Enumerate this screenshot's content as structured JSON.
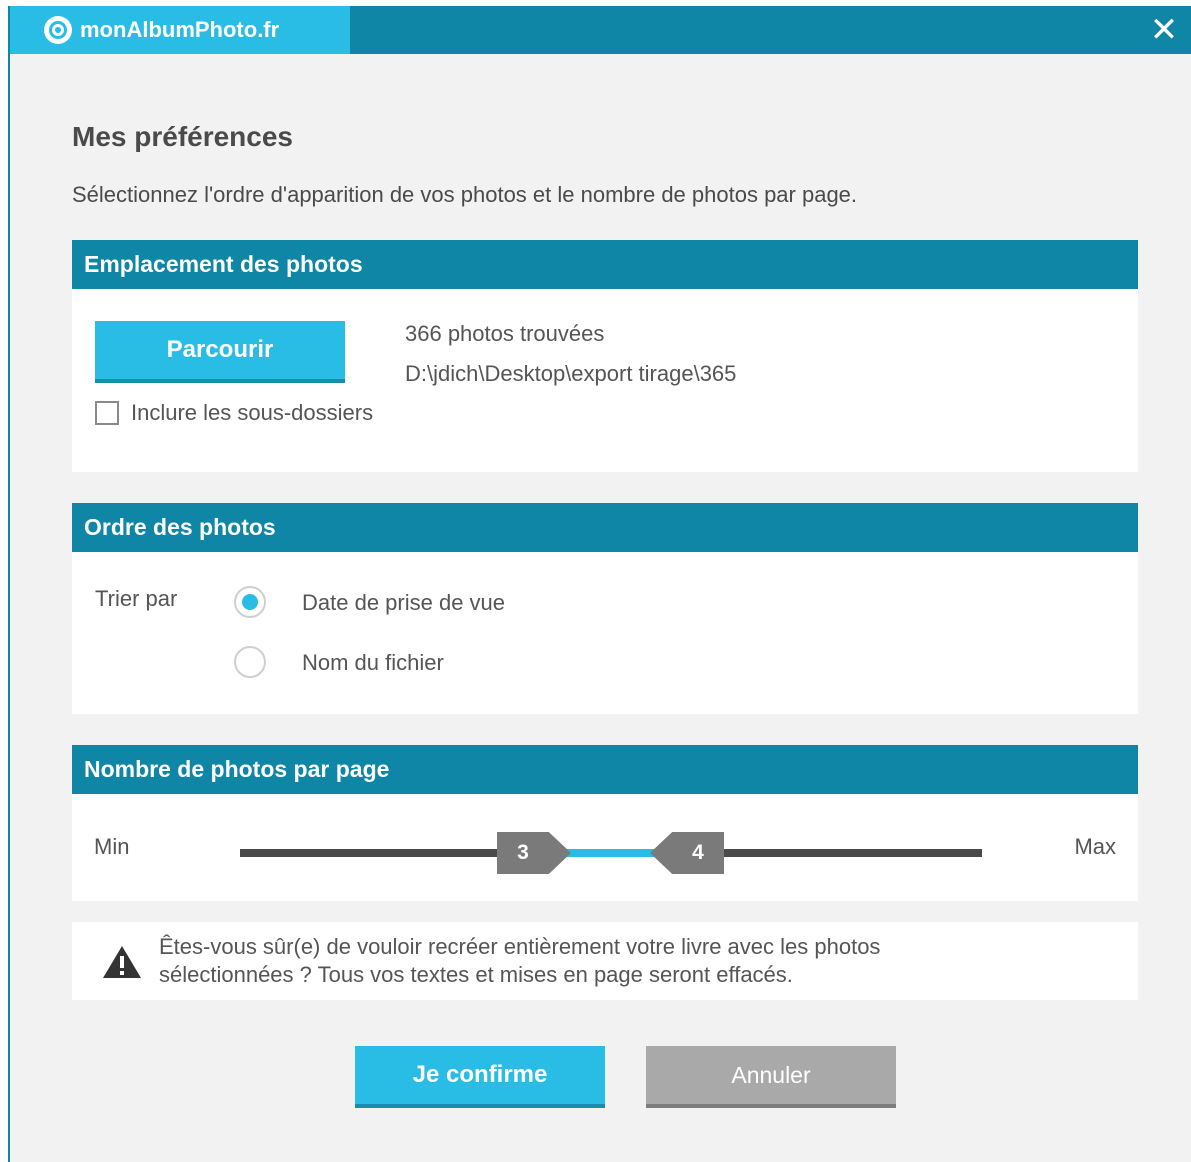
{
  "titlebar": {
    "app_title": "monAlbumPhoto.fr",
    "close_glyph": "✕",
    "icons": {
      "logo": "logo-icon",
      "close": "close-icon"
    }
  },
  "page": {
    "title": "Mes préférences",
    "subtitle": "Sélectionnez l'ordre d'apparition de vos photos et le nombre de photos par page."
  },
  "location_section": {
    "header": "Emplacement des photos",
    "browse_label": "Parcourir",
    "include_subfolders_label": "Inclure les sous-dossiers",
    "include_subfolders_checked": false,
    "found_text": "366 photos trouvées",
    "path_text": "D:\\jdich\\Desktop\\export tirage\\365"
  },
  "order_section": {
    "header": "Ordre des photos",
    "sort_label": "Trier par",
    "options": [
      {
        "label": "Date de prise de vue",
        "selected": true
      },
      {
        "label": "Nom du fichier",
        "selected": false
      }
    ]
  },
  "count_section": {
    "header": "Nombre de photos par page",
    "min_label": "Min",
    "max_label": "Max",
    "range_low": "3",
    "range_high": "4"
  },
  "warning": {
    "icon": "warning-icon",
    "text_line1": "Êtes-vous sûr(e) de vouloir recréer entièrement votre livre avec les photos",
    "text_line2": "sélectionnées ? Tous vos textes et mises en page seront effacés."
  },
  "actions": {
    "confirm_label": "Je confirme",
    "cancel_label": "Annuler"
  },
  "colors": {
    "header_blue": "#0f86a6",
    "accent_blue": "#29bde6",
    "slider_track": "#4a4a4a",
    "handle_gray": "#7a7a7a",
    "cancel_gray": "#a9a9a9"
  }
}
